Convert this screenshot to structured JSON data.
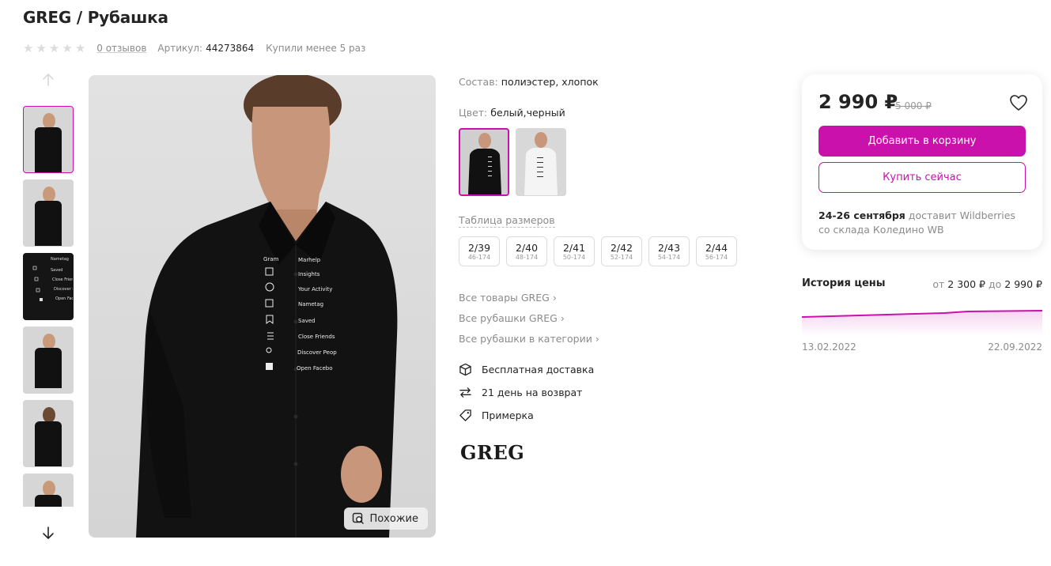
{
  "product": {
    "title": "GREG / Рубашка",
    "reviews": "0 отзывов",
    "article_label": "Артикул:",
    "article": "44273864",
    "bought": "Купили менее 5 раз",
    "rating": 0
  },
  "thumbnails": {
    "up_icon": "arrow-up-icon",
    "down_icon": "arrow-down-icon",
    "count": 6
  },
  "main_image": {
    "similar_label": "Похожие",
    "shirt_print": [
      "Gram",
      "Marhelp",
      "Insights",
      "Your Activity",
      "Nametag",
      "Saved",
      "Close Friends",
      "Discover Peop",
      "Open Facebo"
    ]
  },
  "details": {
    "composition_label": "Состав:",
    "composition": "полиэстер, хлопок",
    "color_label": "Цвет:",
    "color": "белый,черный",
    "size_table": "Таблица размеров",
    "sizes": [
      {
        "size": "2/39",
        "height": "46-174"
      },
      {
        "size": "2/40",
        "height": "48-174"
      },
      {
        "size": "2/41",
        "height": "50-174"
      },
      {
        "size": "2/42",
        "height": "52-174"
      },
      {
        "size": "2/43",
        "height": "54-174"
      },
      {
        "size": "2/44",
        "height": "56-174"
      }
    ],
    "links": [
      "Все товары GREG",
      "Все рубашки GREG",
      "Все рубашки в категории"
    ],
    "features": [
      {
        "icon": "box-icon",
        "text": "Бесплатная доставка"
      },
      {
        "icon": "return-arrows-icon",
        "text": "21 день на возврат"
      },
      {
        "icon": "tag-icon",
        "text": "Примерка"
      }
    ],
    "brand_logo": "GREG"
  },
  "price": {
    "current": "2 990 ₽",
    "old": "5 000 ₽",
    "add_to_cart": "Добавить в корзину",
    "buy_now": "Купить сейчас",
    "delivery_date": "24-26 сентября",
    "delivery_text": " доставит Wildberries",
    "delivery_warehouse": "со склада Коледино WB"
  },
  "history": {
    "title": "История цены",
    "range_from": "от",
    "min": "2 300 ₽",
    "range_to": "до",
    "max": "2 990 ₽",
    "start_date": "13.02.2022",
    "end_date": "22.09.2022"
  },
  "colors": {
    "accent": "#cb11ab",
    "text": "#242424",
    "muted": "#8b8b8b"
  }
}
